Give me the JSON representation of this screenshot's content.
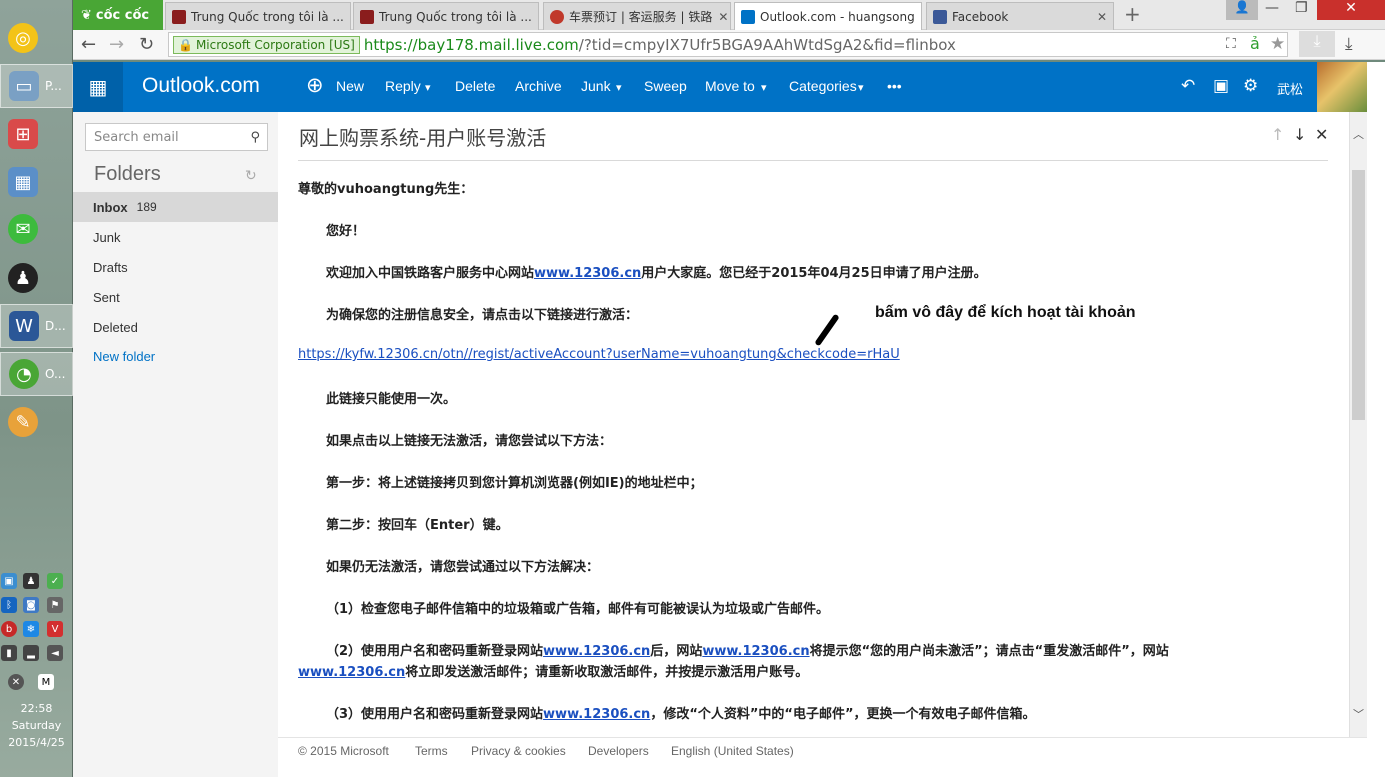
{
  "browser": {
    "brand": "cốc cốc",
    "tabs": [
      {
        "title": "Trung Quốc trong tôi là ...",
        "favicon": "#8a1d1d"
      },
      {
        "title": "Trung Quốc trong tôi là ...",
        "favicon": "#8a1d1d"
      },
      {
        "title": "车票预订 | 客运服务 | 铁路",
        "favicon": "#c0392b"
      },
      {
        "title": "Outlook.com - huangsong",
        "favicon": "#0072c6"
      },
      {
        "title": "Facebook",
        "favicon": "#3b5998"
      }
    ],
    "new_tab": "+",
    "security_label": "Microsoft Corporation [US]",
    "url_host": "https://bay178.mail.live.com",
    "url_rest": "/?tid=cmpyIX7Ufr5BGA9AAhWtdSgA2&fid=flinbox"
  },
  "outlook": {
    "brand": "Outlook.com",
    "commands": {
      "new": "New",
      "reply": "Reply",
      "delete": "Delete",
      "archive": "Archive",
      "junk": "Junk",
      "sweep": "Sweep",
      "move_to": "Move to",
      "categories": "Categories",
      "more": "•••"
    },
    "user_name": "武松"
  },
  "sidebar": {
    "search_placeholder": "Search email",
    "folders_heading": "Folders",
    "items": [
      {
        "label": "Inbox",
        "count": "189"
      },
      {
        "label": "Junk"
      },
      {
        "label": "Drafts"
      },
      {
        "label": "Sent"
      },
      {
        "label": "Deleted"
      }
    ],
    "new_folder": "New folder"
  },
  "message": {
    "subject": "网上购票系统-用户账号激活",
    "lines": {
      "greeting": "尊敬的vuhoangtung先生：",
      "hello": "您好！",
      "welcome_a": "欢迎加入中国铁路客户服务中心网站",
      "welcome_link": "www.12306.cn",
      "welcome_b": "用户大家庭。您已经于2015年04月25日申请了用户注册。",
      "secure": "为确保您的注册信息安全，请点击以下链接进行激活：",
      "activation_link": "https://kyfw.12306.cn/otn//regist/activeAccount?userName=vuhoangtung&checkcode=rHaU",
      "once": "此链接只能使用一次。",
      "if_fail": "如果点击以上链接无法激活，请您尝试以下方法：",
      "step1": "第一步：将上述链接拷贝到您计算机浏览器(例如IE)的地址栏中；",
      "step2": "第二步：按回车（Enter）键。",
      "still_fail": "如果仍无法激活，请您尝试通过以下方法解决：",
      "opt1": "（1）检查您电子邮件信箱中的垃圾箱或广告箱，邮件有可能被误认为垃圾或广告邮件。",
      "opt2_a": "（2）使用用户名和密码重新登录网站",
      "opt2_link1": "www.12306.cn",
      "opt2_b": "后，网站",
      "opt2_link2": "www.12306.cn",
      "opt2_c": "将提示您“您的用户尚未激活”；请点击“重发激活邮件”，网站",
      "opt2_link3": "www.12306.cn",
      "opt2_d": "将立即发送激活邮件；请重新收取激活邮件，并按提示激活用户账号。",
      "opt3_a": "（3）使用用户名和密码重新登录网站",
      "opt3_link": "www.12306.cn",
      "opt3_b": "，修改“个人资料”中的“电子邮件”，更换一个有效电子邮件信箱。"
    },
    "annotation": "bấm vô đây để kích hoạt tài khoản"
  },
  "footer": {
    "copyright": "© 2015 Microsoft",
    "links": [
      "Terms",
      "Privacy & cookies",
      "Developers",
      "English (United States)"
    ]
  },
  "taskbar": {
    "items": [
      {
        "label": "P..."
      },
      {
        "label": "D..."
      },
      {
        "label": "O..."
      }
    ],
    "clock": {
      "time": "22:58",
      "day": "Saturday",
      "date": "2015/4/25"
    }
  }
}
